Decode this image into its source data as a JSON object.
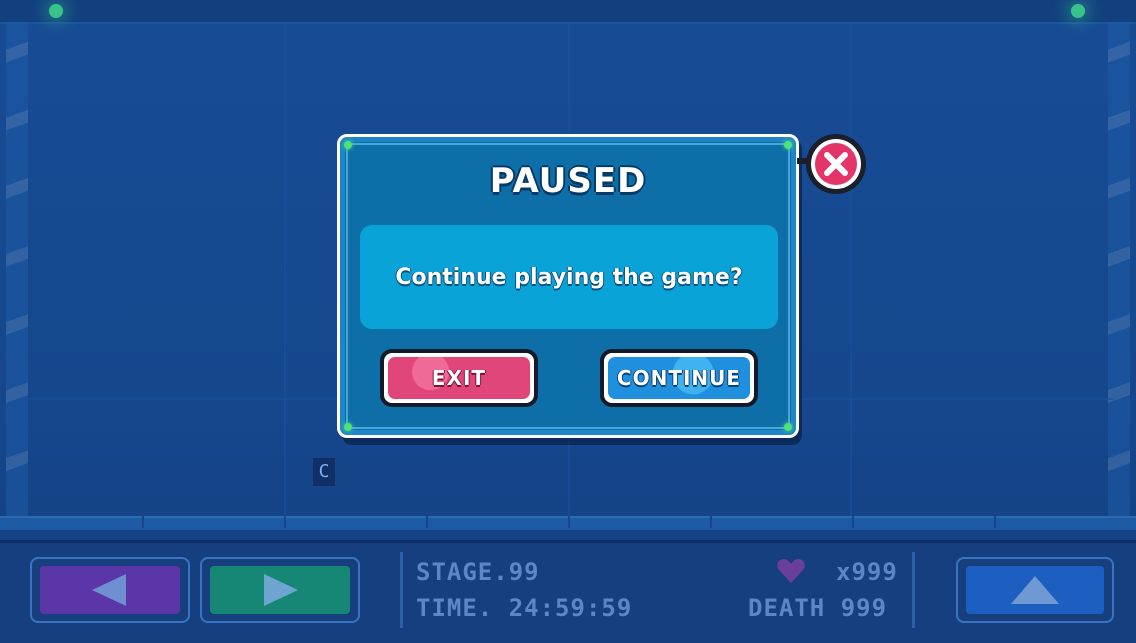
{
  "dialog": {
    "title": "PAUSED",
    "message": "Continue playing the game?",
    "exit_label": "EXIT",
    "continue_label": "CONTINUE",
    "close_icon": "close-x-icon"
  },
  "hud": {
    "stage": "STAGE.99",
    "time": "TIME. 24:59:59",
    "lives": "x999",
    "deaths": "DEATH 999",
    "heart_icon": "heart-icon",
    "left_icon": "arrow-left-icon",
    "right_icon": "arrow-right-icon",
    "jump_icon": "arrow-up-icon"
  },
  "stray_glyph": "C",
  "colors": {
    "background": "#16478d",
    "dialog": "#0e6ea8",
    "exit_button": "#e0467a",
    "continue_button": "#1e90de",
    "close_button": "#e4356b",
    "left_button": "#5b36a8",
    "right_button": "#178775",
    "jump_button": "#1d5fc0",
    "heart": "#6a3f9a"
  }
}
